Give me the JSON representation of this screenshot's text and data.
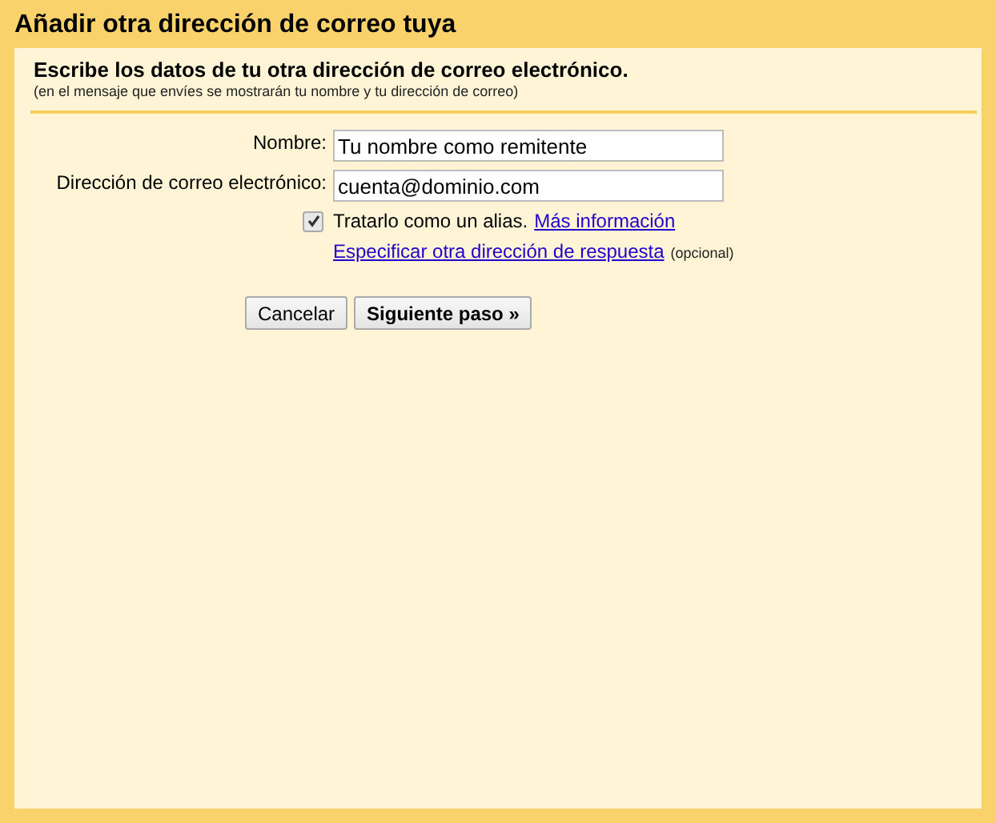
{
  "title": "Añadir otra dirección de correo tuya",
  "heading": "Escribe los datos de tu otra dirección de correo electrónico.",
  "subheading": "(en el mensaje que envíes se mostrarán tu nombre y tu dirección de correo)",
  "fields": [
    {
      "label": "Nombre:",
      "value": "Tu nombre como remitente"
    },
    {
      "label": "Dirección de correo electrónico:",
      "value": "cuenta@dominio.com"
    }
  ],
  "alias": {
    "label": "Tratarlo como un alias.",
    "checked": true,
    "link": "Más información"
  },
  "reply_link": "Especificar otra dirección de respuesta",
  "reply_note": "(opcional)",
  "buttons": [
    {
      "label": "Cancelar",
      "kind": "normal"
    },
    {
      "label": "Siguiente paso »",
      "kind": "primary"
    }
  ]
}
